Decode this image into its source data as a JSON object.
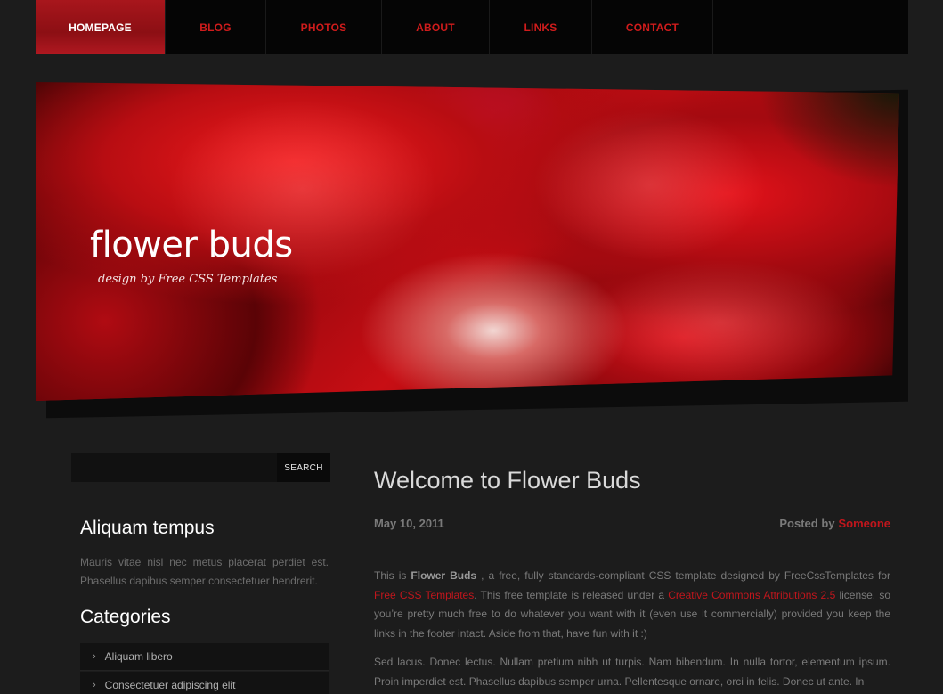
{
  "nav": {
    "items": [
      {
        "label": "HOMEPAGE",
        "active": true
      },
      {
        "label": "BLOG",
        "active": false
      },
      {
        "label": "PHOTOS",
        "active": false
      },
      {
        "label": "ABOUT",
        "active": false
      },
      {
        "label": "LINKS",
        "active": false
      },
      {
        "label": "CONTACT",
        "active": false
      }
    ]
  },
  "hero": {
    "title": "flower buds",
    "subtitle": "design by Free CSS Templates"
  },
  "search": {
    "value": "",
    "placeholder": "",
    "button_label": "SEARCH"
  },
  "sidebar": {
    "about_heading": "Aliquam tempus",
    "about_text": "Mauris vitae nisl nec metus placerat perdiet est. Phasellus dapibus semper consectetuer hendrerit.",
    "categories_heading": "Categories",
    "categories": [
      {
        "label": "Aliquam libero"
      },
      {
        "label": "Consectetuer adipiscing elit"
      }
    ]
  },
  "post": {
    "title": "Welcome to Flower Buds",
    "date": "May 10, 2011",
    "posted_by_label": "Posted by",
    "author": "Someone",
    "p1_before": "This is ",
    "p1_bold": "Flower Buds",
    "p1_mid1": " , a free, fully standards-compliant CSS template designed by FreeCssTemplates for ",
    "p1_link1": "Free CSS Templates",
    "p1_mid2": ". This free template is released under a ",
    "p1_link2": "Creative Commons Attributions 2.5",
    "p1_after": " license, so you’re pretty much free to do whatever you want with it (even use it commercially) provided you keep the links in the footer intact. Aside from that, have fun with it :)",
    "p2": "Sed lacus. Donec lectus. Nullam pretium nibh ut turpis. Nam bibendum. In nulla tortor, elementum ipsum. Proin imperdiet est. Phasellus dapibus semper urna. Pellentesque ornare, orci in felis. Donec ut ante. In"
  },
  "colors": {
    "accent": "#c1161c",
    "background": "#1c1c1c",
    "nav_background": "#050505"
  }
}
